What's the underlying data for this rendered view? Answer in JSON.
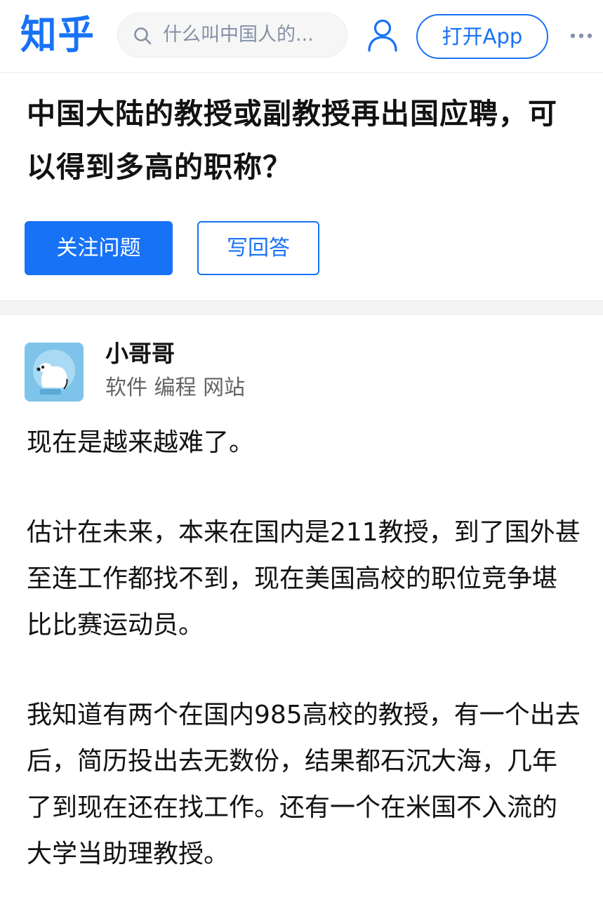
{
  "header": {
    "logo": "知乎",
    "search_placeholder": "什么叫中国人的...",
    "search_icon": "search-icon",
    "user_icon": "user-icon",
    "open_app": "打开App",
    "more_icon": "more-icon",
    "brand_color": "#1772f6"
  },
  "question": {
    "title": "中国大陆的教授或副教授再出国应聘，可以得到多高的职称？",
    "follow_button": "关注问题",
    "answer_button": "写回答"
  },
  "answer": {
    "author": {
      "name": "小哥哥",
      "bio": "软件 编程 网站"
    },
    "paragraphs": [
      "现在是越来越难了。",
      "估计在未来，本来在国内是211教授，到了国外甚至连工作都找不到，现在美国高校的职位竞争堪比比赛运动员。",
      "我知道有两个在国内985高校的教授，有一个出去后，简历投出去无数份，结果都石沉大海，几年了到现在还在找工作。还有一个在米国不入流的大学当助理教授。"
    ]
  }
}
